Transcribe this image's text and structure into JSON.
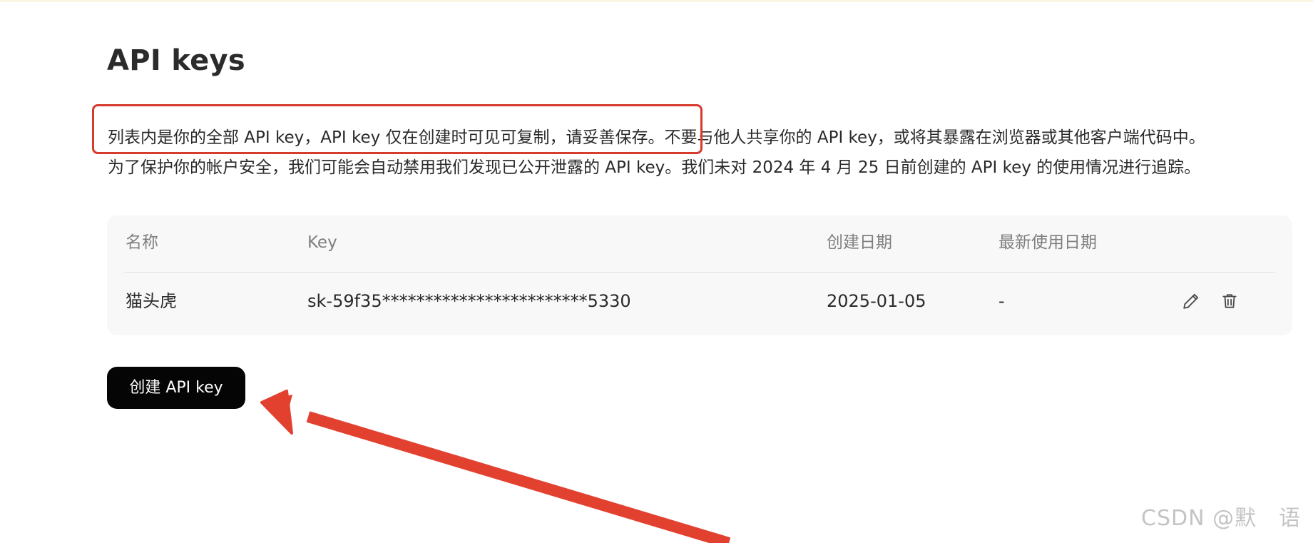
{
  "page": {
    "title": "API keys",
    "description_lines": [
      "列表内是你的全部 API key，API key 仅在创建时可见可复制，请妥善保存。不要与他人共享你的 API key，或将其暴露在浏览器或其他客户端代码中。",
      "为了保护你的帐户安全，我们可能会自动禁用我们发现已公开泄露的 API key。我们未对 2024 年 4 月 25 日前创建的 API key 的使用情况进行追踪。"
    ]
  },
  "table": {
    "columns": [
      "名称",
      "Key",
      "创建日期",
      "最新使用日期"
    ],
    "rows": [
      {
        "name": "猫头虎",
        "key": "sk-59f35************************5330",
        "created": "2025-01-05",
        "last_used": "-"
      }
    ],
    "row_actions": [
      "pencil-icon",
      "trash-icon"
    ]
  },
  "actions": {
    "create_label": "创建 API key"
  },
  "annotations": {
    "highlight_color": "#d63b2c",
    "arrow_color": "#e2412f"
  },
  "watermark": "CSDN @默　语"
}
